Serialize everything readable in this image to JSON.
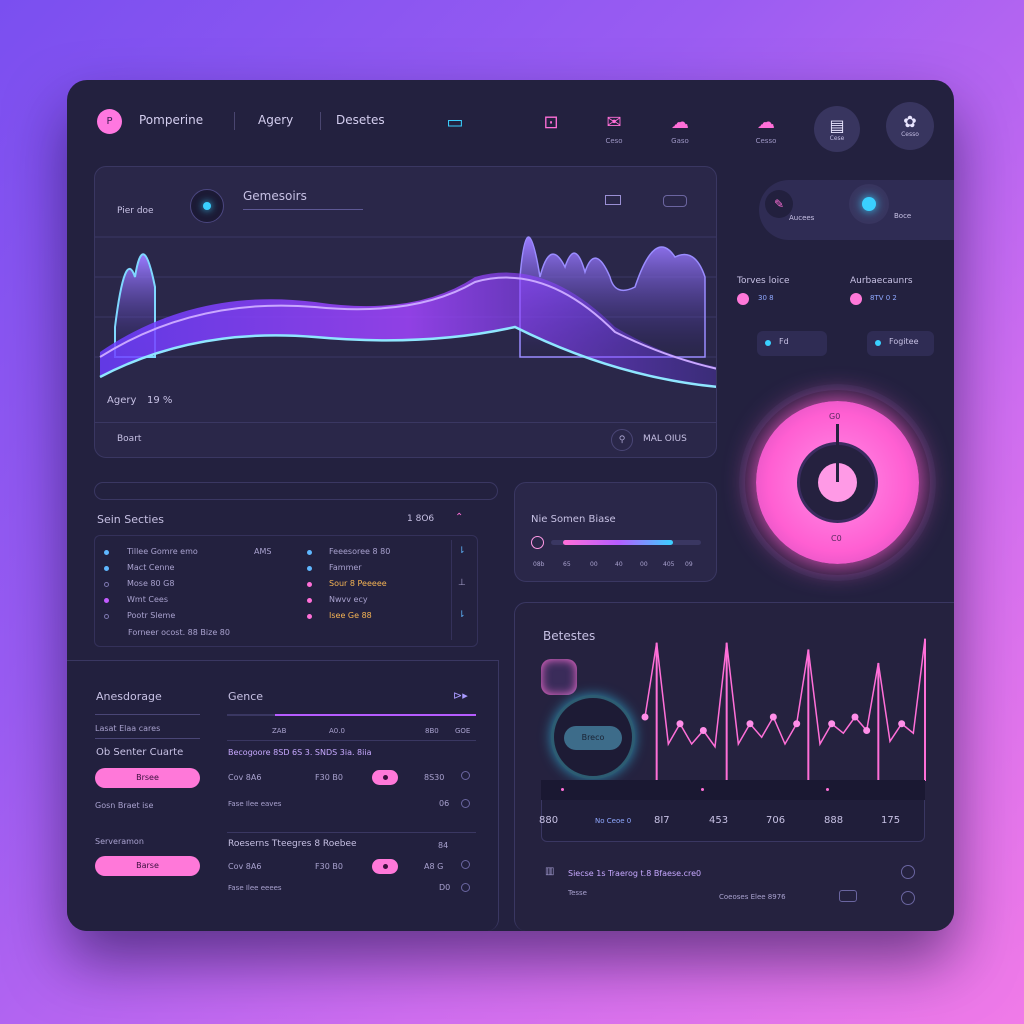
{
  "header": {
    "logo_glyph": "P",
    "app_name": "Pomperine",
    "nav": [
      "Agery",
      "Desetes"
    ],
    "icons": [
      {
        "name": "meter-icon",
        "label": ""
      },
      {
        "name": "car-icon",
        "label": ""
      },
      {
        "name": "chat-icon",
        "label": "Ceso"
      },
      {
        "name": "cloud-icon",
        "label": "Gaso"
      },
      {
        "name": "cloud-alt-icon",
        "label": "Cesso"
      },
      {
        "name": "box-icon",
        "label": "Cese"
      },
      {
        "name": "plant-icon",
        "label": "Cesso"
      }
    ]
  },
  "wave_panel": {
    "left_label": "Pier doe",
    "title": "Gemesoirs",
    "bottom_left": "Agery",
    "bottom_value": "19 %",
    "footer_left": "Boart",
    "footer_right": "MAL OIUS"
  },
  "side_top": {
    "toggle1_label": "Aucees",
    "toggle2_label": "Boce",
    "stat1_title": "Torves loice",
    "stat1_value": "30 8",
    "stat2_title": "Aurbaecaunrs",
    "stat2_value": "8TV 0 2",
    "chip1": "Fd",
    "chip2": "Fogitee"
  },
  "knob": {
    "top_label": "G0",
    "bottom_label": "C0",
    "level": 0.75
  },
  "series_panel": {
    "title": "Sein Secties",
    "right_value": "1 8O6",
    "left_rows": [
      {
        "label": "Tillee Gomre emo",
        "value": "AMS"
      },
      {
        "label": "Mact Cenne",
        "value": ""
      },
      {
        "label": "Mose 80 G8",
        "value": ""
      },
      {
        "label": "Wmt Cees",
        "value": ""
      },
      {
        "label": "Pootr Sleme",
        "value": ""
      }
    ],
    "right_rows": [
      {
        "label": "Feeesoree 8 80",
        "color": "#c7c1e4"
      },
      {
        "label": "Fammer",
        "color": "#c7c1e4"
      },
      {
        "label": "Sour 8 Peeeee",
        "color": "#f5b454"
      },
      {
        "label": "Nwvv ecy",
        "color": "#c7c1e4"
      },
      {
        "label": "Isee Ge 88",
        "color": "#f5b454"
      }
    ],
    "footer": "Forneer ocost. 88 Bize 80"
  },
  "mini_panel": {
    "title": "Nie Somen Biase",
    "ticks": [
      "08b",
      "65",
      "00",
      "40",
      "00",
      "405",
      "09"
    ],
    "level": 0.62
  },
  "settings_panel": {
    "title": "Anesdorage",
    "sub1": "Lasat Elaa cares",
    "heading": "Ob Senter Cuarte",
    "button1": "Brsee",
    "sub2": "Gosn Braet ise",
    "sub3": "Serveramon",
    "button2": "Barse"
  },
  "genre_panel": {
    "title": "Gence",
    "head_values": [
      "ZAB",
      "A0.0",
      "8B0",
      "GOE"
    ],
    "row1_title": "Becogoore 8SD 6S 3. SNDS 3ia. 8iia",
    "row1_cells": [
      "Cov 8A6",
      "F30 B0",
      "0",
      "8S30"
    ],
    "row1_sub": "Fase Ilee eaves",
    "row1_sub_val": "06",
    "row2_title": "Roeserns  Tteegres 8  Roebee",
    "row2_value": "84",
    "row2_cells": [
      "Cov 8A6",
      "F30 B0",
      "0",
      "A8 G"
    ],
    "row2_sub": "Fase Ilee eeees",
    "row2_sub_val": "D0"
  },
  "bars_panel": {
    "title": "Betestes",
    "device_label": "Breco",
    "stats": [
      "880",
      "No Ceoe 0",
      "8I7",
      "453",
      "706",
      "888",
      "175"
    ],
    "footer_line": "Siecse 1s Traerog  t.8 Bfaese.cre0",
    "footer_sub": "Tesse",
    "footer_right": "Coeoses Elee  8976"
  },
  "chart_data": {
    "type": "line",
    "title": "Betestes",
    "series": [
      {
        "values": [
          40,
          95,
          20,
          35,
          20,
          30,
          18,
          95,
          20,
          35,
          25,
          40,
          20,
          35,
          90,
          20,
          35,
          28,
          40,
          30,
          80,
          22,
          35,
          28,
          98
        ]
      }
    ],
    "ylim": [
      0,
      100
    ]
  },
  "colors": {
    "accent": "#ff6fd8",
    "cyan": "#3ad0ff",
    "frame": "#23213f",
    "purple": "#7b4bff"
  }
}
